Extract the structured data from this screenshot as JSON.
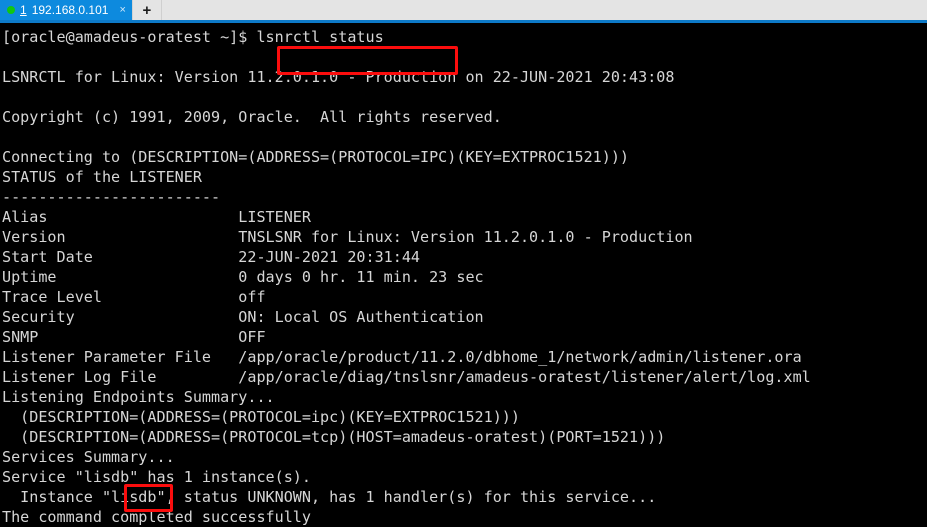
{
  "window": {
    "tabbar": {
      "tabs": [
        {
          "status_icon": "green-dot-icon",
          "index": "1",
          "title": "192.168.0.101",
          "close_label": "×"
        }
      ],
      "new_tab_label": "+"
    },
    "accent_color": "#0d8ade",
    "tabbar_bg_color": "#e4e4e4",
    "underline_color": "#0d7ac8"
  },
  "terminal": {
    "background_color": "#000000",
    "text_color": "#d6d6d6",
    "prompt": "[oracle@amadeus-oratest ~]$ ",
    "command": "lsnrctl status",
    "annotations": [
      {
        "name": "command-highlight",
        "target": "lsnrctl status",
        "color": "#fb0d0d"
      },
      {
        "name": "instance-name-highlight",
        "target": "lisdb",
        "color": "#fb0d0d"
      }
    ],
    "lines": [
      "[oracle@amadeus-oratest ~]$ lsnrctl status",
      "",
      "LSNRCTL for Linux: Version 11.2.0.1.0 - Production on 22-JUN-2021 20:43:08",
      "",
      "Copyright (c) 1991, 2009, Oracle.  All rights reserved.",
      "",
      "Connecting to (DESCRIPTION=(ADDRESS=(PROTOCOL=IPC)(KEY=EXTPROC1521)))",
      "STATUS of the LISTENER",
      "------------------------",
      "Alias                     LISTENER",
      "Version                   TNSLSNR for Linux: Version 11.2.0.1.0 - Production",
      "Start Date                22-JUN-2021 20:31:44",
      "Uptime                    0 days 0 hr. 11 min. 23 sec",
      "Trace Level               off",
      "Security                  ON: Local OS Authentication",
      "SNMP                      OFF",
      "Listener Parameter File   /app/oracle/product/11.2.0/dbhome_1/network/admin/listener.ora",
      "Listener Log File         /app/oracle/diag/tnslsnr/amadeus-oratest/listener/alert/log.xml",
      "Listening Endpoints Summary...",
      "  (DESCRIPTION=(ADDRESS=(PROTOCOL=ipc)(KEY=EXTPROC1521)))",
      "  (DESCRIPTION=(ADDRESS=(PROTOCOL=tcp)(HOST=amadeus-oratest)(PORT=1521)))",
      "Services Summary...",
      "Service \"lisdb\" has 1 instance(s).",
      "  Instance \"lisdb\", status UNKNOWN, has 1 handler(s) for this service...",
      "The command completed successfully"
    ],
    "details": {
      "alias": "LISTENER",
      "version": "TNSLSNR for Linux: Version 11.2.0.1.0 - Production",
      "start_date": "22-JUN-2021 20:31:44",
      "uptime": "0 days 0 hr. 11 min. 23 sec",
      "trace_level": "off",
      "security": "ON: Local OS Authentication",
      "snmp": "OFF",
      "listener_parameter_file": "/app/oracle/product/11.2.0/dbhome_1/network/admin/listener.ora",
      "listener_log_file": "/app/oracle/diag/tnslsnr/amadeus-oratest/listener/alert/log.xml",
      "service_name": "lisdb",
      "instance_name": "lisdb",
      "instance_status": "UNKNOWN"
    }
  }
}
